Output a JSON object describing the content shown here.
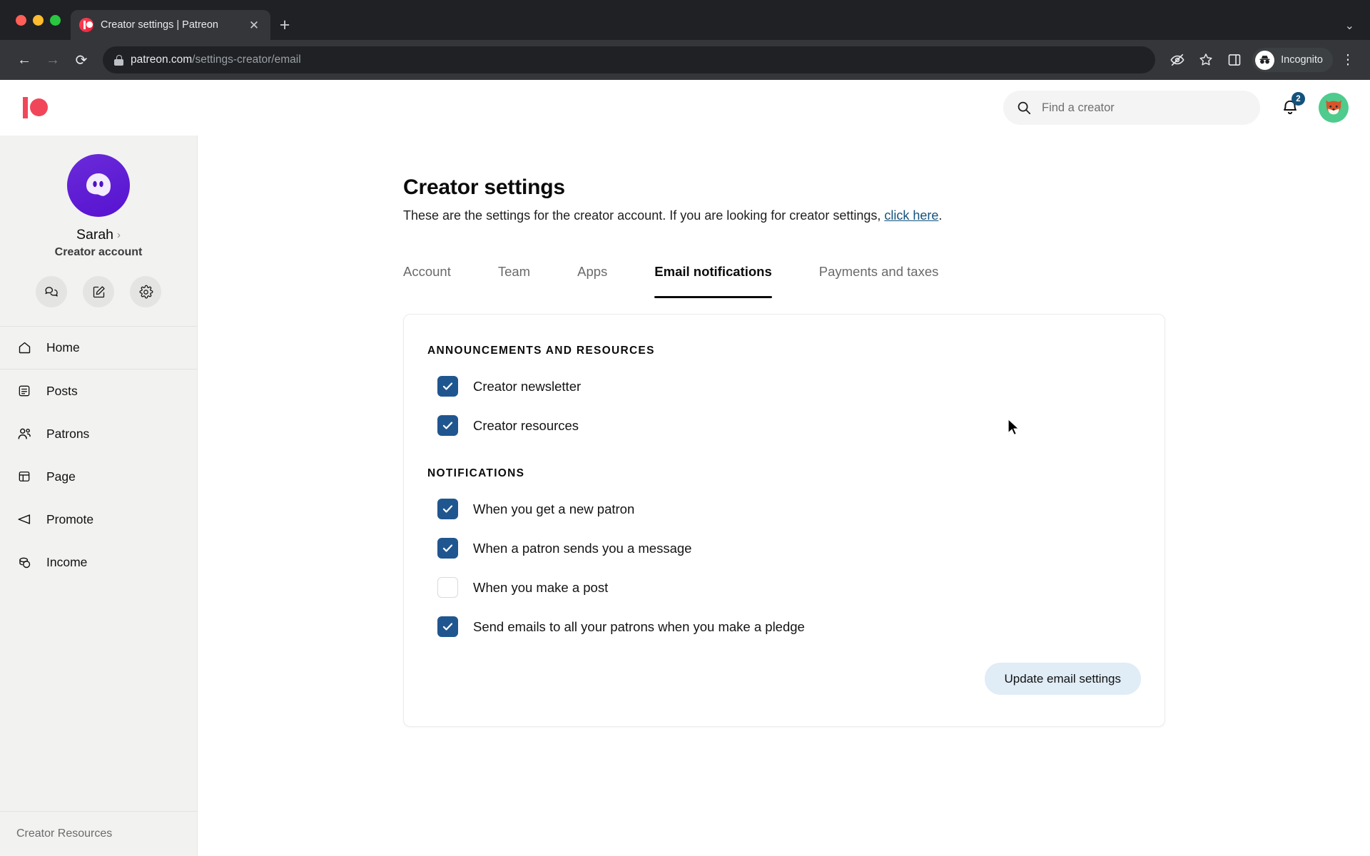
{
  "browser": {
    "tab_title": "Creator settings | Patreon",
    "tab_favicon": "patreon-favicon",
    "close_label": "✕",
    "newtab_label": "+",
    "tabsearch_label": "⌄",
    "back_label": "←",
    "forward_label": "→",
    "reload_label": "⟳",
    "url_domain": "patreon.com",
    "url_path": "/settings-creator/email",
    "profile_label": "Incognito",
    "kebab_label": "⋮"
  },
  "header": {
    "logo": "patreon-logo",
    "search": {
      "placeholder": "Find a creator",
      "icon": "search-icon"
    },
    "notifications": {
      "icon": "bell-icon",
      "count": "2"
    },
    "avatar": "fox-avatar"
  },
  "sidebar": {
    "profile": {
      "avatar": "ghost-avatar",
      "name": "Sarah",
      "chevron": "›",
      "role": "Creator account"
    },
    "quick_actions": [
      {
        "name": "messages-button",
        "icon": "chat-bubbles-icon"
      },
      {
        "name": "create-post-button",
        "icon": "compose-icon"
      },
      {
        "name": "settings-button",
        "icon": "gear-icon"
      }
    ],
    "items": [
      {
        "label": "Home",
        "icon": "home-icon"
      },
      {
        "label": "Posts",
        "icon": "posts-icon"
      },
      {
        "label": "Patrons",
        "icon": "patrons-icon"
      },
      {
        "label": "Page",
        "icon": "page-icon"
      },
      {
        "label": "Promote",
        "icon": "promote-icon"
      },
      {
        "label": "Income",
        "icon": "income-icon"
      }
    ],
    "footer_link": "Creator Resources"
  },
  "main": {
    "title": "Creator settings",
    "subtitle_prefix": "These are the settings for the creator account. If you are looking for creator settings, ",
    "subtitle_link": "click here",
    "subtitle_suffix": ".",
    "tabs": [
      {
        "label": "Account",
        "active": false
      },
      {
        "label": "Team",
        "active": false
      },
      {
        "label": "Apps",
        "active": false
      },
      {
        "label": "Email notifications",
        "active": true
      },
      {
        "label": "Payments and taxes",
        "active": false
      }
    ],
    "sections": [
      {
        "title": "ANNOUNCEMENTS AND RESOURCES",
        "options": [
          {
            "label": "Creator newsletter",
            "checked": true
          },
          {
            "label": "Creator resources",
            "checked": true
          }
        ]
      },
      {
        "title": "NOTIFICATIONS",
        "options": [
          {
            "label": "When you get a new patron",
            "checked": true
          },
          {
            "label": "When a patron sends you a message",
            "checked": true
          },
          {
            "label": "When you make a post",
            "checked": false
          },
          {
            "label": "Send emails to all your patrons when you make a pledge",
            "checked": true
          }
        ]
      }
    ],
    "submit_label": "Update email settings"
  },
  "colors": {
    "brand_red": "#f1465a",
    "checkbox_blue": "#20568f",
    "link_blue": "#14527d",
    "button_bg": "#e0ecf6",
    "avatar_green": "#4ecb8d",
    "ghost_purple": "#5712d0"
  }
}
